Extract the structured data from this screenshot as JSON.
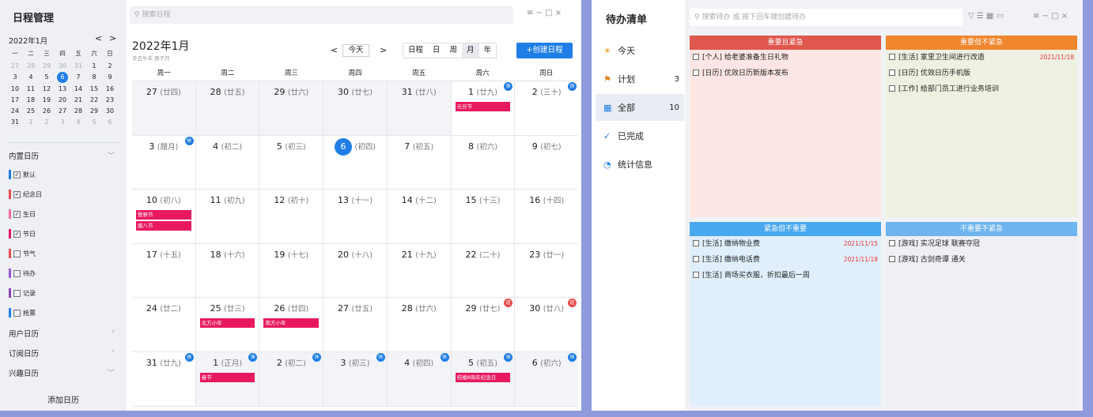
{
  "calendar_app": {
    "title": "日程管理",
    "mini": {
      "month": "2022年1月",
      "prev": "<",
      "next": ">",
      "weekdays": [
        "一",
        "二",
        "三",
        "四",
        "五",
        "六",
        "日"
      ],
      "rows": [
        [
          "27",
          "28",
          "29",
          "30",
          "31",
          "1",
          "2"
        ],
        [
          "3",
          "4",
          "5",
          "6",
          "7",
          "8",
          "9"
        ],
        [
          "10",
          "11",
          "12",
          "13",
          "14",
          "15",
          "16"
        ],
        [
          "17",
          "18",
          "19",
          "20",
          "21",
          "22",
          "23"
        ],
        [
          "24",
          "25",
          "26",
          "27",
          "28",
          "29",
          "30"
        ],
        [
          "31",
          "1",
          "2",
          "3",
          "4",
          "5",
          "6"
        ]
      ]
    },
    "builtin": {
      "label": "内置日历",
      "chev": "﹀"
    },
    "calendars": [
      {
        "label": "默认",
        "color": "#1f7ee6",
        "checked": true
      },
      {
        "label": "纪念日",
        "color": "#e84c4c",
        "checked": true
      },
      {
        "label": "生日",
        "color": "#f06aa0",
        "checked": true
      },
      {
        "label": "节日",
        "color": "#e8195f",
        "checked": true
      },
      {
        "label": "节气",
        "color": "#e84c4c",
        "checked": false
      },
      {
        "label": "待办",
        "color": "#9b59d0",
        "checked": false
      },
      {
        "label": "记录",
        "color": "#8e44ad",
        "checked": false
      },
      {
        "label": "抢票",
        "color": "#1f7ee6",
        "checked": false
      }
    ],
    "sections": [
      {
        "label": "用户日历",
        "chev": "›"
      },
      {
        "label": "订阅日历",
        "chev": "›"
      },
      {
        "label": "兴趣日历",
        "chev": "﹀"
      }
    ],
    "add_calendar": "添加日历",
    "search_placeholder": "搜索日程",
    "head_title": "2022年1月",
    "head_sub": "辛丑牛年 庚子月",
    "prev": "<",
    "today": "今天",
    "next": ">",
    "views": [
      "日程",
      "日",
      "周",
      "月",
      "年"
    ],
    "active_view": "月",
    "create": "+创建日程",
    "win_controls": "≡ − □ ×",
    "week_headers": [
      "周一",
      "周二",
      "周三",
      "周四",
      "周五",
      "周六",
      "周日"
    ],
    "weeks": [
      [
        {
          "d": "27",
          "l": "(廿四)",
          "out": true
        },
        {
          "d": "28",
          "l": "(廿五)",
          "out": true
        },
        {
          "d": "29",
          "l": "(廿六)",
          "out": true
        },
        {
          "d": "30",
          "l": "(廿七)",
          "out": true
        },
        {
          "d": "31",
          "l": "(廿八)",
          "out": true
        },
        {
          "d": "1",
          "l": "(廿九)",
          "badge": "休",
          "bt": "rest",
          "ev": [
            "元旦节"
          ]
        },
        {
          "d": "2",
          "l": "(三十)",
          "badge": "休",
          "bt": "rest"
        }
      ],
      [
        {
          "d": "3",
          "l": "(腊月)",
          "badge": "休",
          "bt": "rest"
        },
        {
          "d": "4",
          "l": "(初二)"
        },
        {
          "d": "5",
          "l": "(初三)"
        },
        {
          "d": "6",
          "l": "(初四)",
          "today": true
        },
        {
          "d": "7",
          "l": "(初五)"
        },
        {
          "d": "8",
          "l": "(初六)"
        },
        {
          "d": "9",
          "l": "(初七)"
        }
      ],
      [
        {
          "d": "10",
          "l": "(初八)",
          "ev": [
            "警察节",
            "腊八节"
          ]
        },
        {
          "d": "11",
          "l": "(初九)"
        },
        {
          "d": "12",
          "l": "(初十)"
        },
        {
          "d": "13",
          "l": "(十一)"
        },
        {
          "d": "14",
          "l": "(十二)"
        },
        {
          "d": "15",
          "l": "(十三)"
        },
        {
          "d": "16",
          "l": "(十四)"
        }
      ],
      [
        {
          "d": "17",
          "l": "(十五)"
        },
        {
          "d": "18",
          "l": "(十六)"
        },
        {
          "d": "19",
          "l": "(十七)"
        },
        {
          "d": "20",
          "l": "(十八)"
        },
        {
          "d": "21",
          "l": "(十九)"
        },
        {
          "d": "22",
          "l": "(二十)"
        },
        {
          "d": "23",
          "l": "(廿一)"
        }
      ],
      [
        {
          "d": "24",
          "l": "(廿二)"
        },
        {
          "d": "25",
          "l": "(廿三)",
          "ev": [
            "北方小年"
          ]
        },
        {
          "d": "26",
          "l": "(廿四)",
          "ev": [
            "南方小年"
          ]
        },
        {
          "d": "27",
          "l": "(廿五)"
        },
        {
          "d": "28",
          "l": "(廿六)"
        },
        {
          "d": "29",
          "l": "(廿七)",
          "badge": "班",
          "bt": "work"
        },
        {
          "d": "30",
          "l": "(廿八)",
          "badge": "班",
          "bt": "work"
        }
      ],
      [
        {
          "d": "31",
          "l": "(廿九)",
          "badge": "休",
          "bt": "rest"
        },
        {
          "d": "1",
          "l": "(正月)",
          "badge": "休",
          "bt": "rest",
          "ev": [
            "春节"
          ],
          "out": true
        },
        {
          "d": "2",
          "l": "(初二)",
          "badge": "休",
          "bt": "rest",
          "out": true
        },
        {
          "d": "3",
          "l": "(初三)",
          "badge": "休",
          "bt": "rest",
          "out": true
        },
        {
          "d": "4",
          "l": "(初四)",
          "badge": "休",
          "bt": "rest",
          "out": true
        },
        {
          "d": "5",
          "l": "(初五)",
          "badge": "休",
          "bt": "rest",
          "ev": [
            "结婚8周年纪念日"
          ],
          "out": true
        },
        {
          "d": "6",
          "l": "(初六)",
          "badge": "休",
          "bt": "rest",
          "out": true
        }
      ]
    ]
  },
  "todo_app": {
    "title": "待办清单",
    "nav": [
      {
        "icon": "☀",
        "label": "今天",
        "count": "",
        "color": "#f0a020"
      },
      {
        "icon": "⚑",
        "label": "计划",
        "count": "3",
        "color": "#e08020"
      },
      {
        "icon": "▦",
        "label": "全部",
        "count": "10",
        "color": "#1f7ee6",
        "active": true
      },
      {
        "icon": "✓",
        "label": "已完成",
        "count": "",
        "color": "#1f7ee6"
      },
      {
        "icon": "◔",
        "label": "统计信息",
        "count": "",
        "color": "#1f7ee6"
      }
    ],
    "search_placeholder": "搜索待办 或 按下回车键创建待办",
    "win_controls": "≡ − □ ×",
    "quadrants": [
      {
        "title": "重要且紧急",
        "head": "#e0574d",
        "bg": "#fde6e3",
        "items": [
          {
            "text": "[个人] 给老婆准备生日礼物",
            "date": ""
          },
          {
            "text": "[日历] 优效日历新版本发布",
            "date": ""
          }
        ]
      },
      {
        "title": "重要但不紧急",
        "head": "#f0862e",
        "bg": "#eef0e2",
        "items": [
          {
            "text": "[生活] 家里卫生间进行改造",
            "date": "2021/11/18"
          },
          {
            "text": "[日历] 优效日历手机版",
            "date": ""
          },
          {
            "text": "[工作] 给部门员工进行业务培训",
            "date": ""
          }
        ]
      },
      {
        "title": "紧急但不重要",
        "head": "#4aa8ef",
        "bg": "#e1effc",
        "items": [
          {
            "text": "[生活] 缴纳物业费",
            "date": "2021/11/15"
          },
          {
            "text": "[生活] 缴纳电话费",
            "date": "2021/11/18"
          },
          {
            "text": "[生活] 商场买衣服，折扣最后一周",
            "date": ""
          }
        ]
      },
      {
        "title": "不重要不紧急",
        "head": "#6eb4ef",
        "bg": "#eef0f5",
        "items": [
          {
            "text": "[游戏] 实况足球 联赛夺冠",
            "date": ""
          },
          {
            "text": "[游戏] 古剑奇谭 通关",
            "date": ""
          }
        ]
      }
    ]
  }
}
